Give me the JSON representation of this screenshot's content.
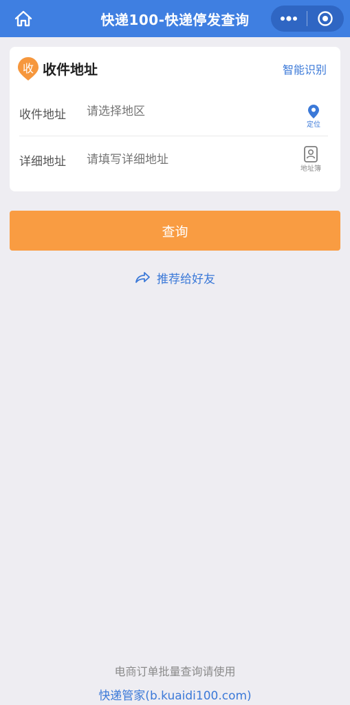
{
  "header": {
    "title": "快递100-快递停发查询",
    "icons": {
      "home": "home-icon",
      "more": "more-dots-icon",
      "close": "target-circle-icon"
    },
    "bg_color": "#3f7fe1"
  },
  "card": {
    "badge_text": "收",
    "title": "收件地址",
    "smart_link": "智能识别",
    "rows": [
      {
        "label": "收件地址",
        "placeholder": "请选择地区",
        "action": "定位"
      },
      {
        "label": "详细地址",
        "placeholder": "请填写详细地址",
        "action": "地址簿"
      }
    ]
  },
  "query_button": {
    "label": "查询",
    "color": "#f99c42"
  },
  "share": {
    "label": "推荐给好友"
  },
  "footer": {
    "note": "电商订单批量查询请使用",
    "link": "快递管家(b.kuaidi100.com)"
  },
  "colors": {
    "accent": "#3b79d8",
    "background": "#eeedf2"
  }
}
